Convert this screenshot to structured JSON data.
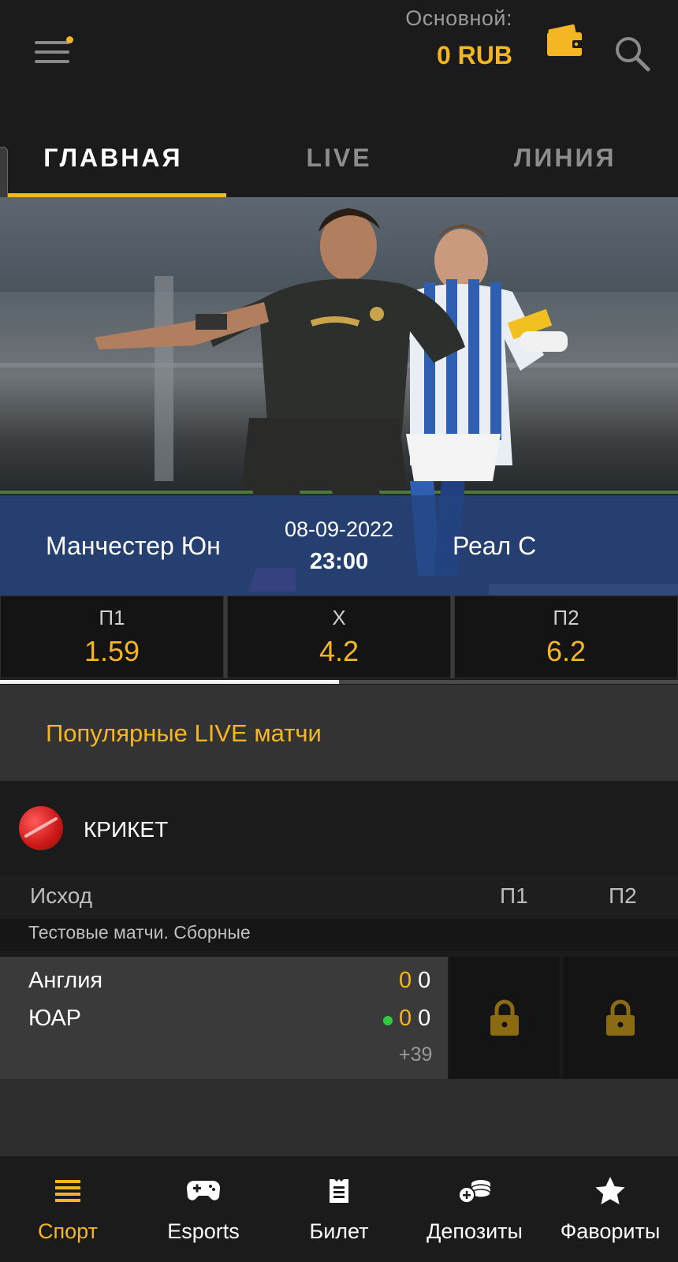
{
  "header": {
    "balance_label": "Основной:",
    "balance_value": "0 RUB",
    "icons": [
      "menu-icon",
      "wallet-icon",
      "search-icon"
    ]
  },
  "tabs": [
    {
      "label": "ГЛАВНАЯ",
      "active": true
    },
    {
      "label": "LIVE",
      "active": false
    },
    {
      "label": "ЛИНИЯ",
      "active": false
    }
  ],
  "banner": {
    "team_home": "Манчестер Юн",
    "team_away": "Реал С",
    "date": "08-09-2022",
    "time": "23:00"
  },
  "odds": [
    {
      "label": "П1",
      "value": "1.59"
    },
    {
      "label": "X",
      "value": "4.2"
    },
    {
      "label": "П2",
      "value": "6.2"
    }
  ],
  "carousel_position": 0.5,
  "popular": {
    "title": "Популярные LIVE матчи"
  },
  "sport": {
    "name": "КРИКЕТ",
    "icon": "cricket-ball-icon"
  },
  "market": {
    "outcome_label": "Исход",
    "col_p1": "П1",
    "col_p2": "П2",
    "league": "Тестовые матчи. Сборные"
  },
  "match": {
    "team1": "Англия",
    "team2": "ЮАР",
    "team1_score_main": "0",
    "team1_score_sub": "0",
    "team2_score_main": "0",
    "team2_score_sub": "0",
    "more": "+39",
    "locked": true
  },
  "bottom_nav": [
    {
      "label": "Спорт",
      "icon": "sport-list-icon",
      "active": true
    },
    {
      "label": "Esports",
      "icon": "gamepad-icon",
      "active": false
    },
    {
      "label": "Билет",
      "icon": "ticket-icon",
      "active": false
    },
    {
      "label": "Депозиты",
      "icon": "coins-icon",
      "active": false
    },
    {
      "label": "Фавориты",
      "icon": "star-icon",
      "active": false
    }
  ],
  "colors": {
    "accent": "#f5b623",
    "background": "#1b1b1b",
    "banner_strip": "#244480",
    "live_dot": "#2ecc40"
  }
}
